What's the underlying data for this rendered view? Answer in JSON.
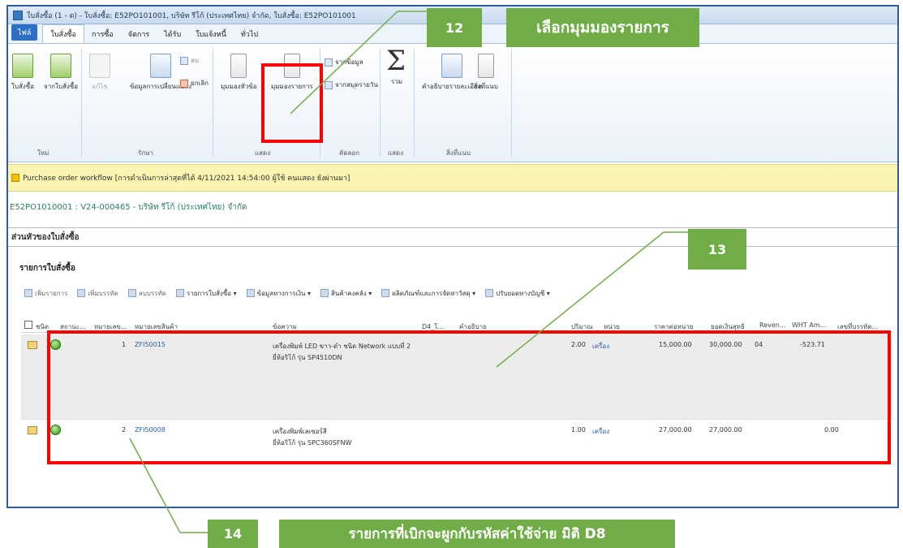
{
  "window": {
    "title": "ใบสั่งซื้อ (1 - ต) - ใบสั่งซื้อ: E52PO101001, บริษัท รีโก้ (ประเทศไทย) จำกัด, ใบสั่งซื้อ: E52PO101001"
  },
  "menu": {
    "file": "ไฟล์",
    "tabs": [
      "ใบสั่งซื้อ",
      "การซื้อ",
      "จัดการ",
      "ได้รับ",
      "ใบแจ้งหนี้",
      "ทั่วไป"
    ]
  },
  "ribbon": {
    "buttons": {
      "purchase_order": "ใบสั่งซื้อ",
      "receipt_list": "จากใบสั่งซื้อ",
      "edit": "แก้ไข",
      "edit_list": "ข้อมูลการเปลี่ยนแปลง",
      "delete": "ลบ",
      "delete_sub": "ยกเลิก",
      "header_view": "มุมมองหัวข้อ",
      "line_view": "มุมมองรายการ",
      "copy_from": "จากข้อมูล",
      "copy_journal": "จากสมุดรายวัน",
      "totals": "รวม",
      "related_info": "คำอธิบายรายละเอียด",
      "attachments": "สิ่งที่แนบ"
    },
    "groups": [
      "ใหม่",
      "รักษา",
      "แสดง",
      "คัดลอก",
      "แสดง",
      "สิ่งที่แนบ"
    ]
  },
  "infobar": {
    "text": "Purchase order workflow [การดำเนินการล่าสุดที่ได้ 4/11/2021 14:54:00 ผู้ใช้ คนแสดง ยังผ่านมา]"
  },
  "record_header": "E52PO1010001 : V24-000465 - บริษัท รีโก้ (ประเทศไทย) จำกัด",
  "section_title": "ส่วนหัวของใบสั่งซื้อ",
  "lines_title": "รายการใบสั่งซื้อ",
  "lines_toolbar": [
    "เพิ่มรายการ",
    "เพิ่มบรรทัด",
    "ลบบรรทัด",
    "รายการใบสั่งซื้อ ▾",
    "ข้อมูลทางการเงิน ▾",
    "สินค้าคงคลัง ▾",
    "ผลิตภัณฑ์และการจัดหาวัสดุ ▾",
    "ปรับยอดทางบัญชี ▾"
  ],
  "columns": [
    "ชนิด",
    "สถานะ...",
    "หมายเลข...",
    "หมายเลขสินค้า",
    "ข้อความ",
    "D4_โ...",
    "คำอธิบาย",
    "ปริมาณ",
    "หน่วย",
    "ราคาต่อหน่วย",
    "ยอดเงินสุทธิ",
    "Reven...",
    "WHT Am...",
    "เลขที่บรรทัด..."
  ],
  "rows": [
    {
      "line": "1",
      "item": "ZFI50015",
      "text1": "เครื่องพิมพ์ LED ขาว-ดำ ชนิด Network แบบที่ 2",
      "text2": "ยี่ห้อริโก้ รุ่น SP4510DN",
      "qty": "2.00",
      "unit": "เครื่อง",
      "price": "15,000.00",
      "net": "30,000.00",
      "rev": "04",
      "wht": "-523.71"
    },
    {
      "line": "2",
      "item": "ZFI50008",
      "text1": "เครื่องพิมพ์เลเซอร์สี",
      "text2": "ยี่ห้อริโก้ รุ่น SPC360SFNW",
      "qty": "1.00",
      "unit": "เครื่อง",
      "price": "27,000.00",
      "net": "27,000.00",
      "rev": "",
      "wht": "0.00"
    }
  ],
  "callouts": {
    "c12_num": "12",
    "c12_text": "เลือกมุมมองรายการ",
    "c13_num": "13",
    "c14_num": "14",
    "c14_text": "รายการที่เบิกจะผูกกับรหัสค่าใช้จ่าย มิติ D8"
  },
  "colors": {
    "callout": "#70ad47",
    "highlight": "#ff0000",
    "infobar": "#fbf3b0"
  }
}
